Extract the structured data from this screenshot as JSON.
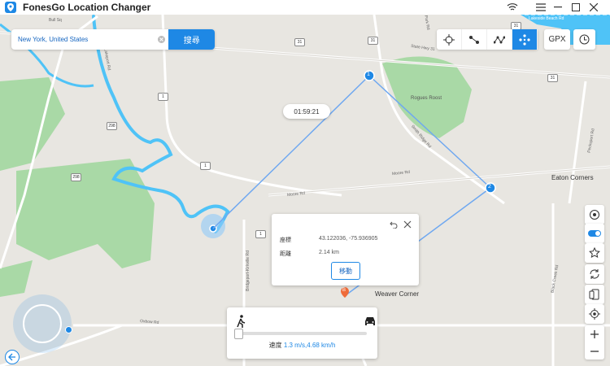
{
  "app": {
    "title": "FonesGo Location Changer"
  },
  "search": {
    "value": "New York, United States",
    "button": "搜尋"
  },
  "toolbar": {
    "gpx": "GPX",
    "modes": [
      "teleport-icon",
      "two-spot-icon",
      "multi-spot-icon",
      "joystick-icon"
    ]
  },
  "route": {
    "timer": "01:59:21",
    "spots": [
      "1",
      "2"
    ],
    "destination_marker": "B"
  },
  "info_panel": {
    "coords_label": "座標",
    "coords_value": "43.122036, -75.936905",
    "distance_label": "距離",
    "distance_value": "2.14 km",
    "move_button": "移動"
  },
  "speed_panel": {
    "label": "速度",
    "value": "1.3 m/s,4.68 km/h"
  },
  "map": {
    "places": [
      "Weaver Corner",
      "Eaton Corners",
      "Rogues Roost"
    ],
    "roads": [
      "Bull Sq",
      "State Hwy 31",
      "Moore Rd",
      "Smith Ridge Rd",
      "Bridgeport-Kirkville Rd",
      "Oxbow Rd",
      "Black Creek Rd",
      "Lakeport Rd",
      "Lakeside Beach Rd",
      "Lee Park Rd",
      "Pecksport Rd"
    ],
    "shields": [
      "31",
      "31",
      "31",
      "298",
      "298",
      "1",
      "1",
      "1",
      "31"
    ]
  },
  "colors": {
    "accent": "#1e88e5",
    "route": "#6fa8f0",
    "park": "#a9d9a6",
    "water": "#4fc3f7"
  }
}
